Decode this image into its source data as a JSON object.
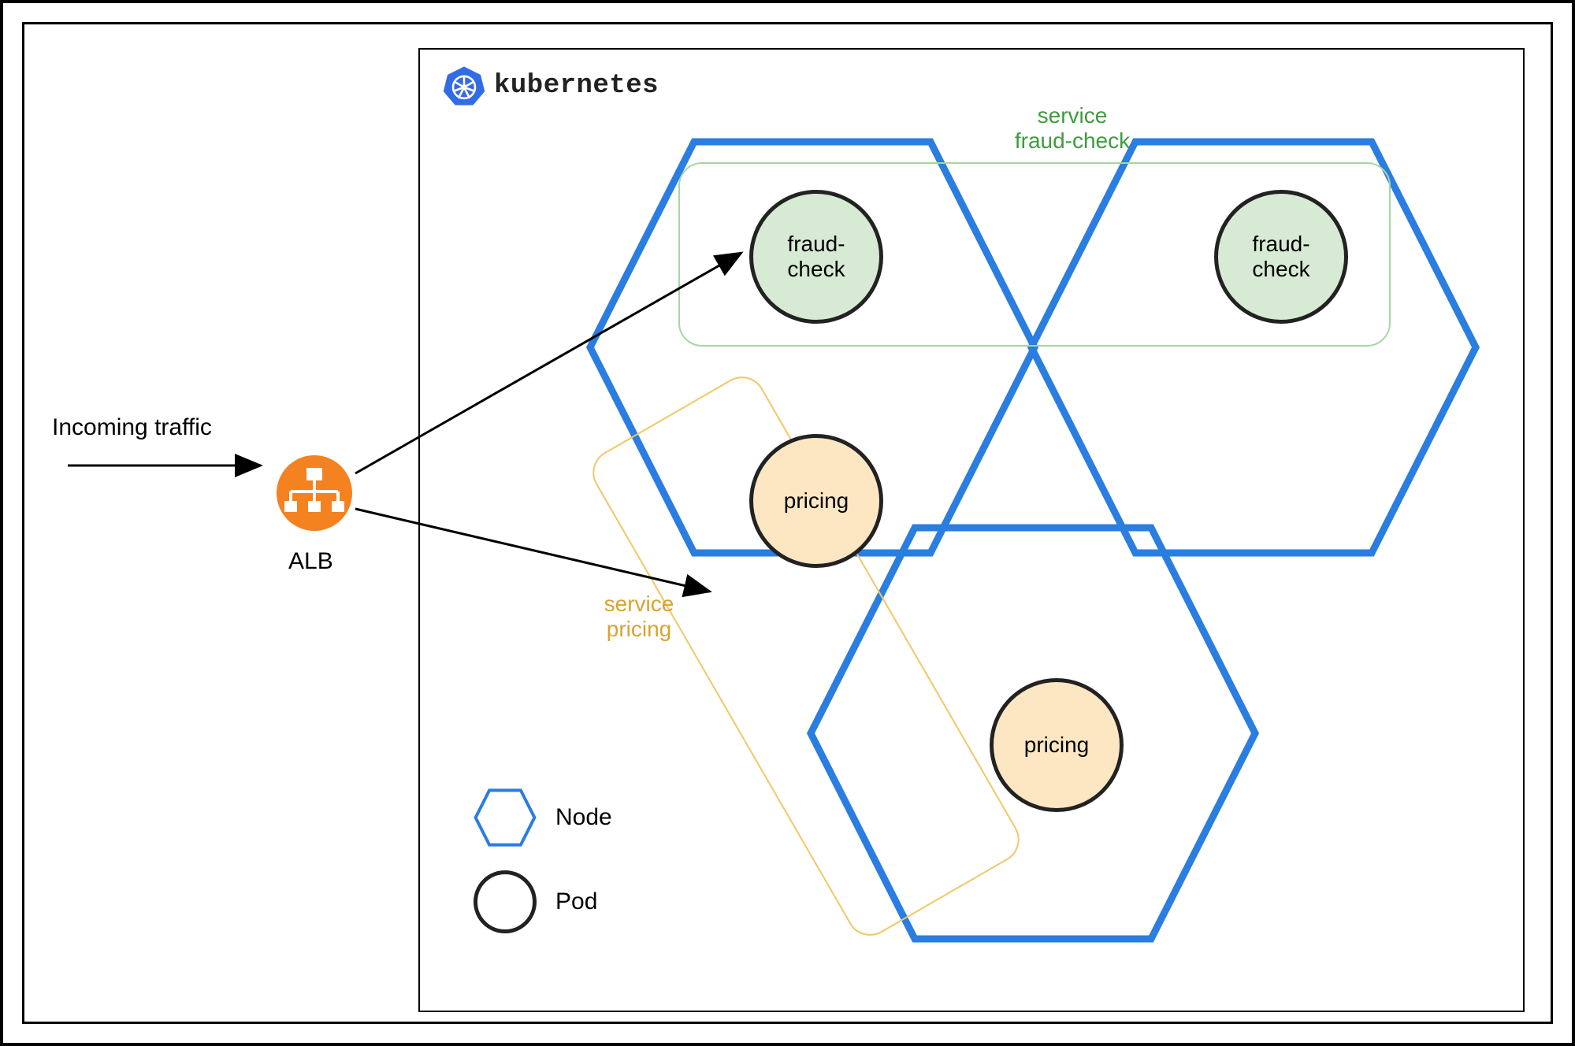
{
  "labels": {
    "incoming": "Incoming traffic",
    "alb": "ALB",
    "k8s": "kubernetes"
  },
  "services": {
    "fraud": {
      "label_line1": "service",
      "label_line2": "fraud-check"
    },
    "pricing": {
      "label_line1": "service",
      "label_line2": "pricing"
    }
  },
  "pods": {
    "fraud": {
      "line1": "fraud-",
      "line2": "check"
    },
    "pricing": {
      "line1": "pricing"
    }
  },
  "legend": {
    "node": "Node",
    "pod": "Pod"
  },
  "colors": {
    "node_stroke": "#2a7de1",
    "pod_fraud_fill": "#d7ead4",
    "pod_pricing_fill": "#fde7c2",
    "service_fraud_border": "#a6d7a0",
    "service_pricing_border": "#f2c766",
    "alb_fill": "#f58220"
  }
}
